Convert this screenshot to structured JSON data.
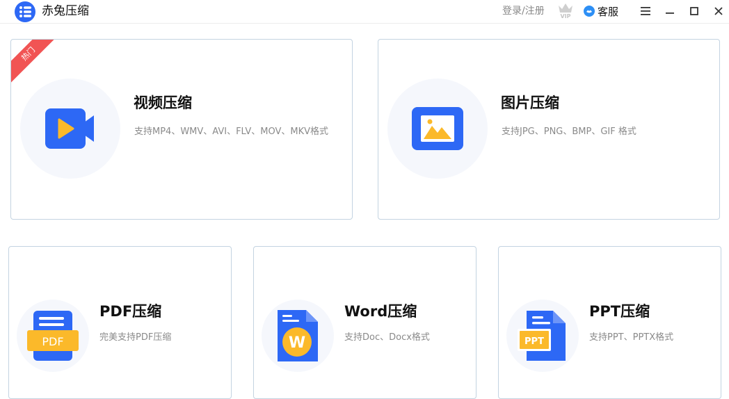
{
  "app": {
    "title": "赤兔压缩"
  },
  "header": {
    "login_label": "登录/注册",
    "vip_label": "VIP",
    "service_label": "客服"
  },
  "cards": {
    "video": {
      "title": "视频压缩",
      "desc": "支持MP4、WMV、AVI、FLV、MOV、MKV格式",
      "badge": "热门"
    },
    "image": {
      "title": "图片压缩",
      "desc": "支持JPG、PNG、BMP、GIF 格式"
    },
    "pdf": {
      "title": "PDF压缩",
      "desc": "完美支持PDF压缩",
      "icon_text": "PDF"
    },
    "word": {
      "title": "Word压缩",
      "desc": "支持Doc、Docx格式",
      "icon_text": "W"
    },
    "ppt": {
      "title": "PPT压缩",
      "desc": "支持PPT、PPTX格式",
      "icon_text": "PPT"
    }
  },
  "colors": {
    "brand": "#2d68f5",
    "accent": "#fbb92a",
    "hot": "#f15454",
    "card_border": "#c3d3e1"
  },
  "icons": {
    "logo": "list-icon",
    "vip": "crown-icon",
    "service": "service-icon",
    "menu": "menu-icon",
    "minimize": "minimize-icon",
    "maximize": "maximize-icon",
    "close": "close-icon"
  }
}
